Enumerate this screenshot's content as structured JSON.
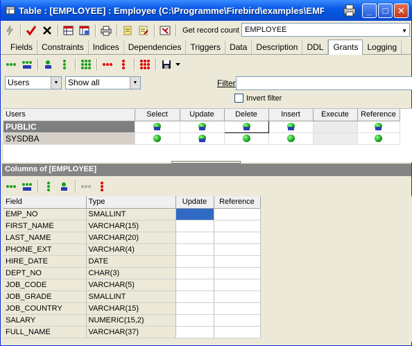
{
  "window": {
    "title": "Table : [EMPLOYEE] : Employee (C:\\Programme\\Firebird\\examples\\EMPLOY",
    "controls": {
      "minimize": "_",
      "maximize": "□",
      "close": "✕"
    }
  },
  "toolbar": {
    "get_record_count_label": "Get record count",
    "table_combo_value": "EMPLOYEE",
    "icons": [
      "lightning-icon",
      "commit-check-icon",
      "rollback-x-icon",
      "table-grid-icon",
      "table-edit-icon",
      "print-icon",
      "script-icon",
      "script-edit-icon",
      "property-icon"
    ]
  },
  "tabs": [
    {
      "label": "Fields",
      "active": false
    },
    {
      "label": "Constraints",
      "active": false
    },
    {
      "label": "Indices",
      "active": false
    },
    {
      "label": "Dependencies",
      "active": false
    },
    {
      "label": "Triggers",
      "active": false
    },
    {
      "label": "Data",
      "active": false
    },
    {
      "label": "Description",
      "active": false
    },
    {
      "label": "DDL",
      "active": false
    },
    {
      "label": "Grants",
      "active": true
    },
    {
      "label": "Logging",
      "active": false
    }
  ],
  "filters": {
    "object_type": "Users",
    "show_mode": "Show all",
    "filter_label": "Filter",
    "filter_value": "",
    "invert_filter_label": "Invert filter",
    "invert_filter_checked": false
  },
  "grants": {
    "columns": [
      "Users",
      "Select",
      "Update",
      "Delete",
      "Insert",
      "Execute",
      "Reference"
    ],
    "rows": [
      {
        "user": "PUBLIC",
        "selected": true,
        "select": "grant-option",
        "update": "grant-option",
        "delete": "grant-option",
        "insert": "grant-option",
        "execute": "",
        "reference": "grant-option"
      },
      {
        "user": "SYSDBA",
        "selected": false,
        "select": "grant",
        "update": "grant-option",
        "delete": "grant",
        "insert": "grant",
        "execute": "",
        "reference": "grant"
      }
    ]
  },
  "columns_section": {
    "title": "Columns of [EMPLOYEE]",
    "headers": [
      "Field",
      "Type",
      "Update",
      "Reference"
    ],
    "rows": [
      {
        "field": "EMP_NO",
        "type": "SMALLINT"
      },
      {
        "field": "FIRST_NAME",
        "type": "VARCHAR(15)"
      },
      {
        "field": "LAST_NAME",
        "type": "VARCHAR(20)"
      },
      {
        "field": "PHONE_EXT",
        "type": "VARCHAR(4)"
      },
      {
        "field": "HIRE_DATE",
        "type": "DATE"
      },
      {
        "field": "DEPT_NO",
        "type": "CHAR(3)"
      },
      {
        "field": "JOB_CODE",
        "type": "VARCHAR(5)"
      },
      {
        "field": "JOB_GRADE",
        "type": "SMALLINT"
      },
      {
        "field": "JOB_COUNTRY",
        "type": "VARCHAR(15)"
      },
      {
        "field": "SALARY",
        "type": "NUMERIC(15,2)"
      },
      {
        "field": "FULL_NAME",
        "type": "VARCHAR(37)"
      }
    ]
  },
  "colors": {
    "titlebar": "#0a5ae8",
    "selection": "#316ac5",
    "grant_dot": "#1b9e1b",
    "section_header": "#848484"
  }
}
